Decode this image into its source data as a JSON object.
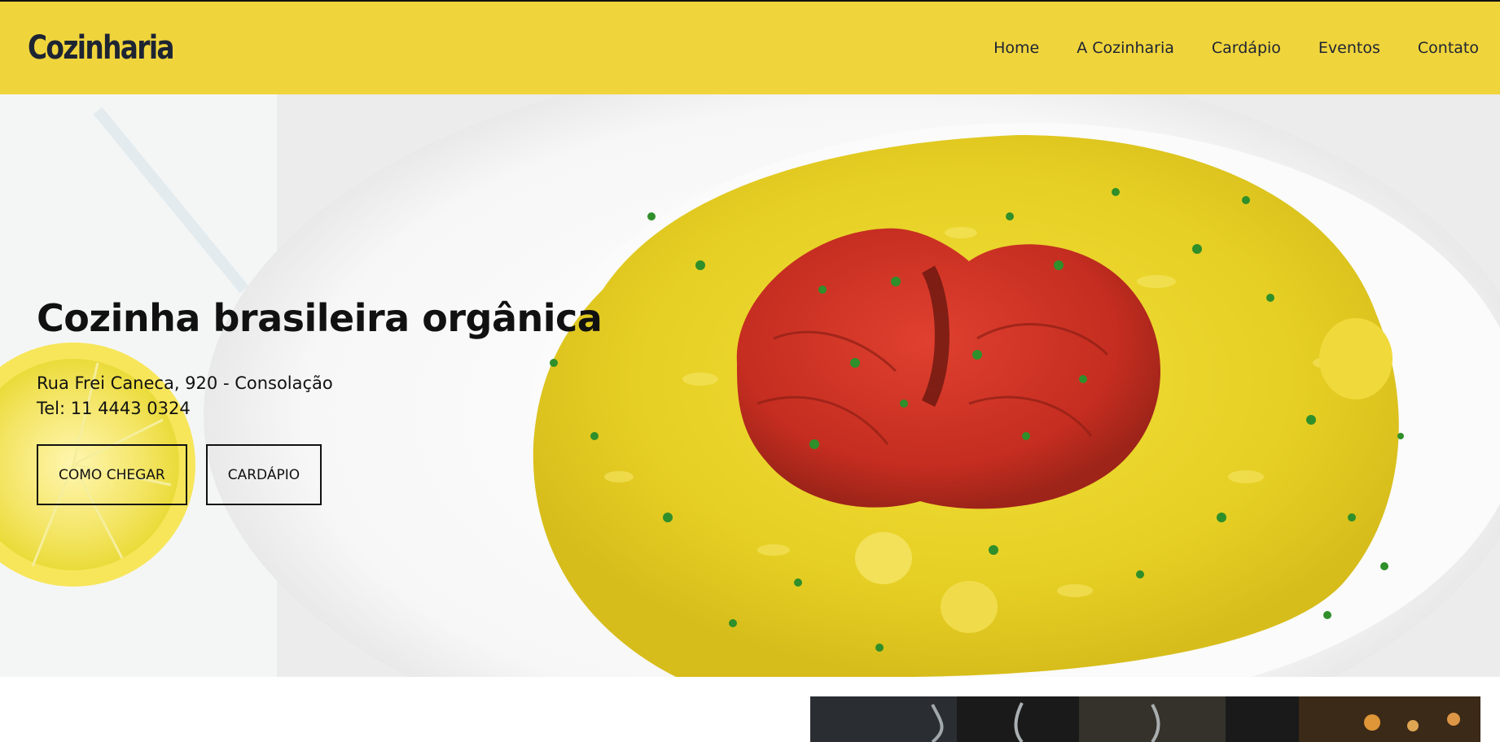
{
  "header": {
    "logo": "Cozinharia",
    "nav": [
      "Home",
      "A Cozinharia",
      "Cardápio",
      "Eventos",
      "Contato"
    ]
  },
  "hero": {
    "title": "Cozinha brasileira orgânica",
    "address": "Rua Frei Caneca, 920 - Consolação",
    "phone": "Tel: 11 4443 0324",
    "buttons": [
      "COMO CHEGAR",
      "CARDÁPIO"
    ]
  },
  "colors": {
    "header_bg": "#f0d43c",
    "text": "#111111",
    "logo": "#1d2433"
  }
}
